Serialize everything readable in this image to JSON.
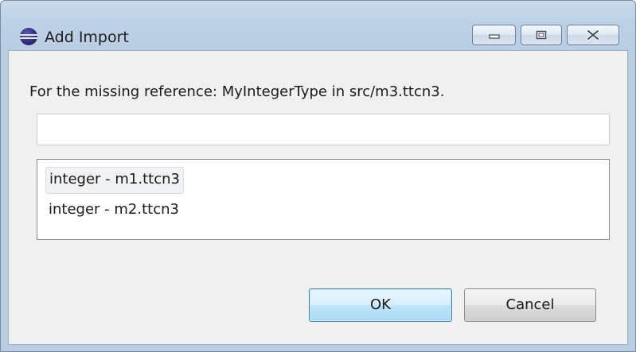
{
  "window": {
    "title": "Add Import",
    "icon": "eclipse-icon",
    "controls": {
      "minimize": "minimize-icon",
      "maximize": "maximize-icon",
      "close": "close-icon"
    }
  },
  "dialog": {
    "message": "For the missing reference: MyIntegerType in src/m3.ttcn3.",
    "filter": {
      "value": "",
      "placeholder": ""
    },
    "list": {
      "items": [
        {
          "label": "integer - m1.ttcn3",
          "selected": true
        },
        {
          "label": "integer - m2.ttcn3",
          "selected": false
        }
      ]
    },
    "buttons": {
      "ok": "OK",
      "cancel": "Cancel"
    }
  },
  "colors": {
    "titlebar": "#bcd0e6",
    "body": "#f0f0f0",
    "default_button": "#bfe4fa"
  }
}
